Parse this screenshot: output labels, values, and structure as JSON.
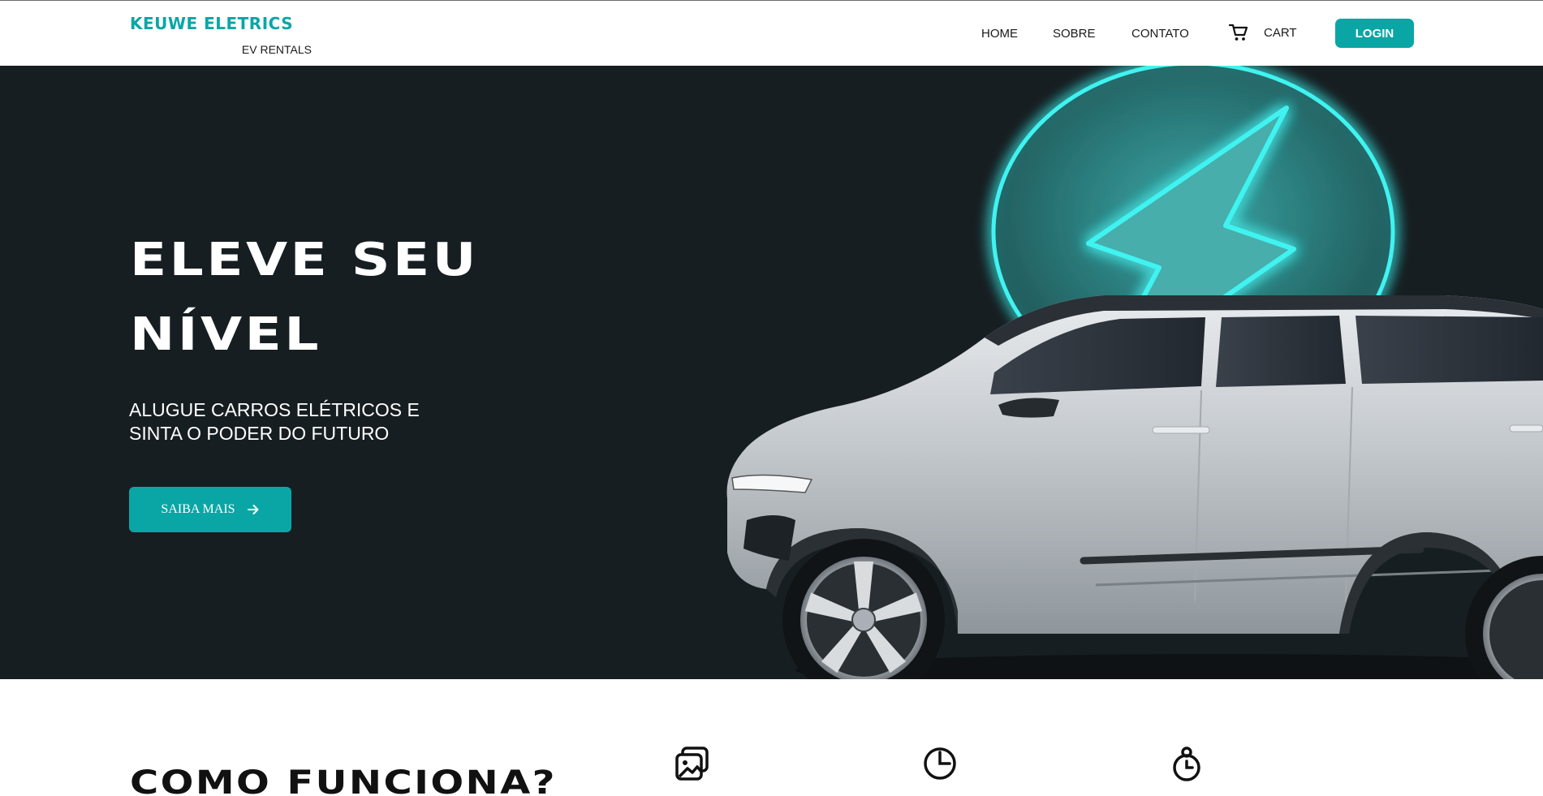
{
  "navbar": {
    "brand_name": "KEUWE ELETRICS",
    "brand_sub": "EV RENTALS",
    "links": {
      "home": "HOME",
      "sobre": "SOBRE",
      "contato": "CONTATO",
      "cart": "CART"
    },
    "login_label": "LOGIN"
  },
  "hero": {
    "title_line1": "ELEVE SEU",
    "title_line2": "NÍVEL",
    "subtitle_line1": "ALUGUE CARROS ELÉTRICOS E",
    "subtitle_line2": "SINTA O PODER DO FUTURO",
    "cta_label": "SAIBA MAIS",
    "cta_icon": "arrow-right-icon",
    "art": [
      "neon-lightning-icon",
      "electric-car-image"
    ]
  },
  "how": {
    "title": "COMO FUNCIONA?",
    "icons": [
      "photos-icon",
      "clock-icon",
      "stopwatch-icon"
    ]
  },
  "colors": {
    "accent": "#0aa6a6",
    "hero_bg": "#171e21",
    "neon": "#3ff3f0"
  }
}
